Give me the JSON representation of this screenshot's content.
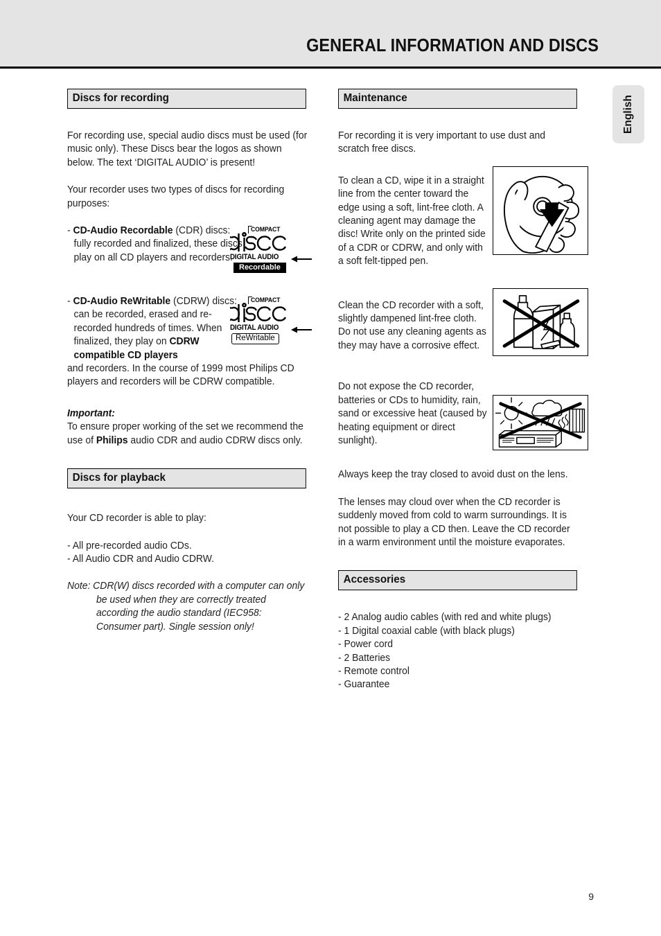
{
  "header": {
    "title": "GENERAL INFORMATION AND DISCS"
  },
  "lang_tab": {
    "label": "English"
  },
  "page_number": "9",
  "left_column": {
    "section_recording": {
      "heading": "Discs for recording",
      "para1": "For recording use, special audio discs must be used (for music only). These Discs bear the logos as shown below. The text ‘DIGITAL AUDIO’ is present!",
      "para2": "Your recorder uses two types of discs for recording purposes:",
      "disc_cdr": {
        "bullet": "- ",
        "bold_label": "CD-Audio Recordable",
        "rest": " (CDR) discs: fully recorded and finalized, these discs play on all CD players and recorders.",
        "logo": {
          "compact": "COMPACT",
          "disc": "disc",
          "digital_audio": "DIGITAL AUDIO",
          "badge": "Recordable",
          "badge_style": "filled"
        }
      },
      "disc_cdrw": {
        "bullet": "- ",
        "bold_label": "CD-Audio ReWritable",
        "part1": " (CDRW) discs: can be recorded, erased and re-recorded hundreds of times. When finalized, they play on ",
        "bold_label2": "CDRW compatible CD players",
        "part2": " and recorders. In the course of 1999 most Philips CD players and recorders will be CDRW compatible.",
        "logo": {
          "compact": "COMPACT",
          "disc": "disc",
          "digital_audio": "DIGITAL AUDIO",
          "badge": "ReWritable",
          "badge_style": "outline"
        }
      },
      "important_label": "Important:",
      "important_text_1": "To ensure proper working of the set we recommend the use of ",
      "important_bold": "Philips",
      "important_text_2": " audio CDR and audio CDRW discs only."
    },
    "section_playback": {
      "heading": "Discs for playback",
      "intro": "Your CD recorder is able to play:",
      "items": [
        "- All pre-recorded audio CDs.",
        "- All Audio CDR and Audio CDRW."
      ],
      "note": "Note: CDR(W) discs recorded with a computer can only be used when they are correctly treated according the audio standard (IEC958: Consumer part). Single session only!"
    }
  },
  "right_column": {
    "section_maintenance": {
      "heading": "Maintenance",
      "para1": "For recording it is very important to use dust and scratch free discs.",
      "para2": "To clean a CD, wipe it in a straight line from the center toward the edge using a soft, lint-free cloth. A cleaning agent may damage the disc! Write only on the printed side of a CDR or CDRW, and only with a soft felt-tipped pen.",
      "para3": "Clean the CD recorder with a soft, slightly dampened lint-free cloth. Do not use any cleaning agents as they may have a corrosive effect.",
      "para4": "Do not expose the CD recorder, batteries or CDs to humidity, rain, sand or excessive heat (caused by heating equipment or direct sunlight).",
      "para5": "Always keep the tray closed to avoid dust on the lens.",
      "para6": "The lenses may cloud over when the CD recorder is suddenly moved from cold to warm surroundings. It is not possible to play a CD then. Leave the CD recorder in a warm environment until the moisture evaporates.",
      "illustrations": [
        {
          "name": "cleaning-cd-with-cloth",
          "caption": ""
        },
        {
          "name": "no-cleaning-agents",
          "caption": ""
        },
        {
          "name": "no-heat-humidity-sunlight",
          "caption": ""
        }
      ]
    },
    "section_accessories": {
      "heading": "Accessories",
      "items": [
        "- 2 Analog audio cables (with red and white plugs)",
        "- 1 Digital coaxial cable (with black plugs)",
        "- Power cord",
        "- 2 Batteries",
        "- Remote control",
        "- Guarantee"
      ]
    }
  },
  "colors": {
    "header_band": "#e4e4e4",
    "section_heading_bg": "#e4e4e4",
    "text": "#222222",
    "rule": "#000000"
  }
}
